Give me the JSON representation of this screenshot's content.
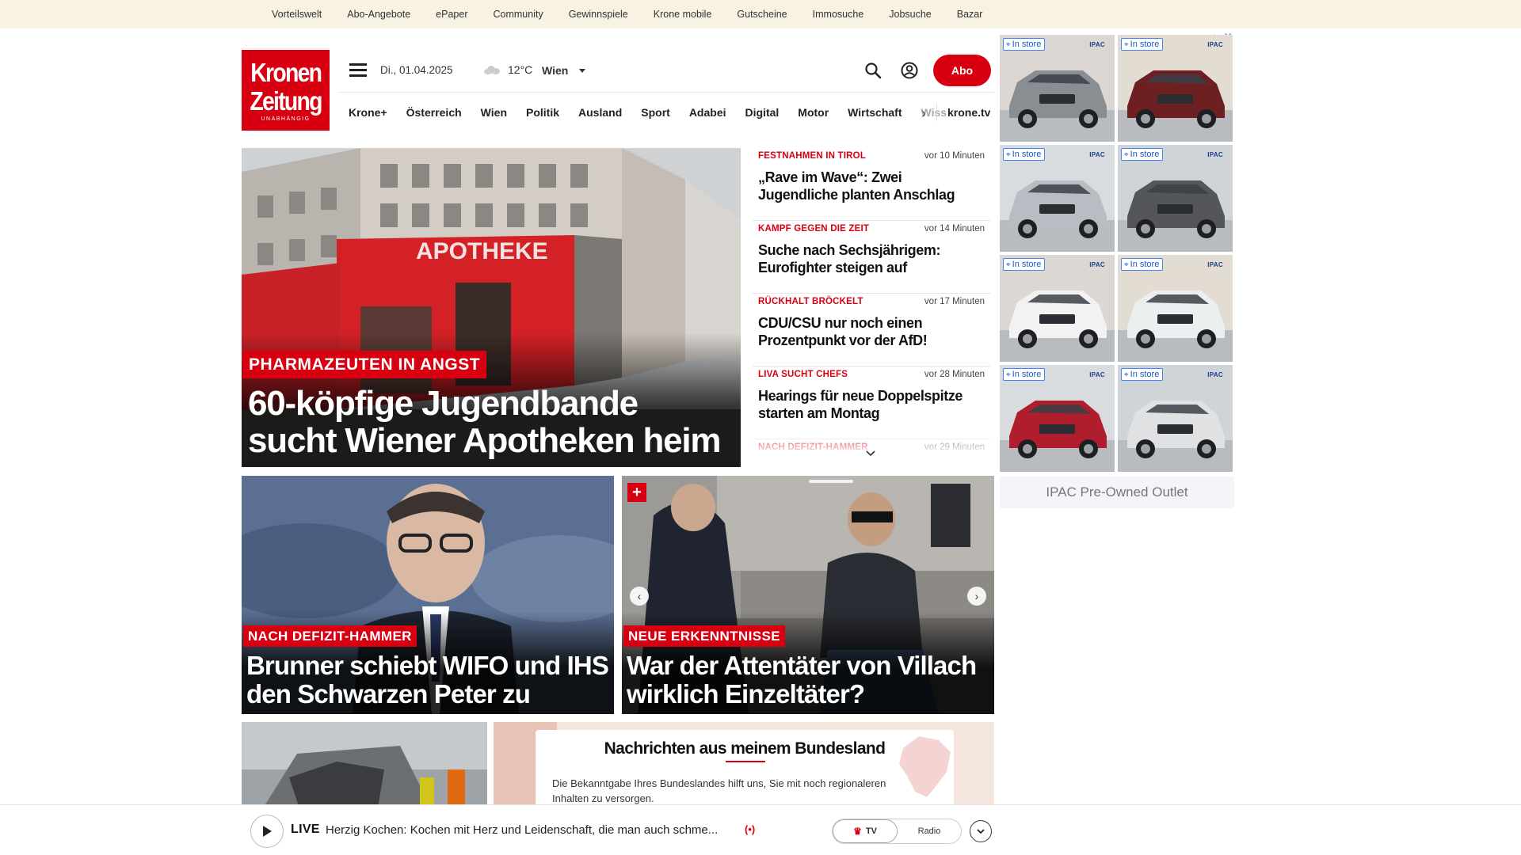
{
  "topbar": {
    "links": [
      "Vorteilswelt",
      "Abo-Angebote",
      "ePaper",
      "Community",
      "Gewinnspiele",
      "Krone mobile",
      "Gutscheine",
      "Immosuche",
      "Jobsuche",
      "Bazar"
    ]
  },
  "logo": {
    "line1": "Kronen",
    "line2": "Zeitung",
    "tagline": "UNABHÄNGIG"
  },
  "header": {
    "date": "Di., 01.04.2025",
    "temperature": "12°C",
    "city": "Wien",
    "abo_label": "Abo",
    "menu_icon": "hamburger-menu-icon",
    "search_icon": "search-icon",
    "account_icon": "account-icon"
  },
  "nav": {
    "items": [
      "Krone+",
      "Österreich",
      "Wien",
      "Politik",
      "Ausland",
      "Sport",
      "Adabei",
      "Digital",
      "Motor",
      "Wirtschaft"
    ],
    "faded_item": "Wiss",
    "tv_label": "krone.tv"
  },
  "hero": {
    "kicker": "PHARMAZEUTEN IN ANGST",
    "headline": "60-köpfige Jugendbande sucht Wiener Apotheken heim",
    "sign_text": "APOTHEKE"
  },
  "ticker": [
    {
      "kicker": "FESTNAHMEN IN TIROL",
      "time": "vor 10 Minuten",
      "headline": "„Rave im Wave“: Zwei Jugendliche planten Anschlag"
    },
    {
      "kicker": "KAMPF GEGEN DIE ZEIT",
      "time": "vor 14 Minuten",
      "headline": "Suche nach Sechsjährigem: Eurofighter steigen auf"
    },
    {
      "kicker": "RÜCKHALT BRÖCKELT",
      "time": "vor 17 Minuten",
      "headline": "CDU/CSU nur noch einen Prozentpunkt vor der AfD!"
    },
    {
      "kicker": "LIVA SUCHT CHEFS",
      "time": "vor 28 Minuten",
      "headline": "Hearings für neue Doppelspitze starten am Montag"
    },
    {
      "kicker": "NACH DEFIZIT-HAMMER",
      "time": "vor 29 Minuten",
      "headline": ""
    }
  ],
  "cards": [
    {
      "kicker": "NACH DEFIZIT-HAMMER",
      "headline": "Brunner schiebt WIFO und IHS den Schwarzen Peter zu"
    },
    {
      "kicker": "NEUE ERKENNTNISSE",
      "headline": "War der Attentäter von Villach wirklich Einzeltäter?",
      "badge": "+"
    }
  ],
  "region": {
    "title": "Nachrichten aus meinem Bundesland",
    "description": "Die Bekanntgabe Ihres Bundeslandes hilft uns, Sie mit noch regionaleren Inhalten zu versorgen."
  },
  "livebar": {
    "live_label": "LIVE",
    "title": "Herzig Kochen: Kochen mit Herz und Leidenschaft, die man auch schme...",
    "radio_icon": "(•)",
    "tv_option": "TV",
    "radio_option": "Radio"
  },
  "ad": {
    "badge_label": "In store",
    "brand": "IPAC",
    "footer": "IPAC Pre-Owned Outlet",
    "choices_icon": "▷",
    "close_icon": "✕",
    "car_colors": [
      "#8a8d92",
      "#6e1f22",
      "#b9bcc2",
      "#545659",
      "#f2f2f2",
      "#eceff0",
      "#b01d2c",
      "#e0e1e3"
    ]
  },
  "colors": {
    "brand_red": "#d80010",
    "topbar_bg": "#f7f2e2"
  }
}
